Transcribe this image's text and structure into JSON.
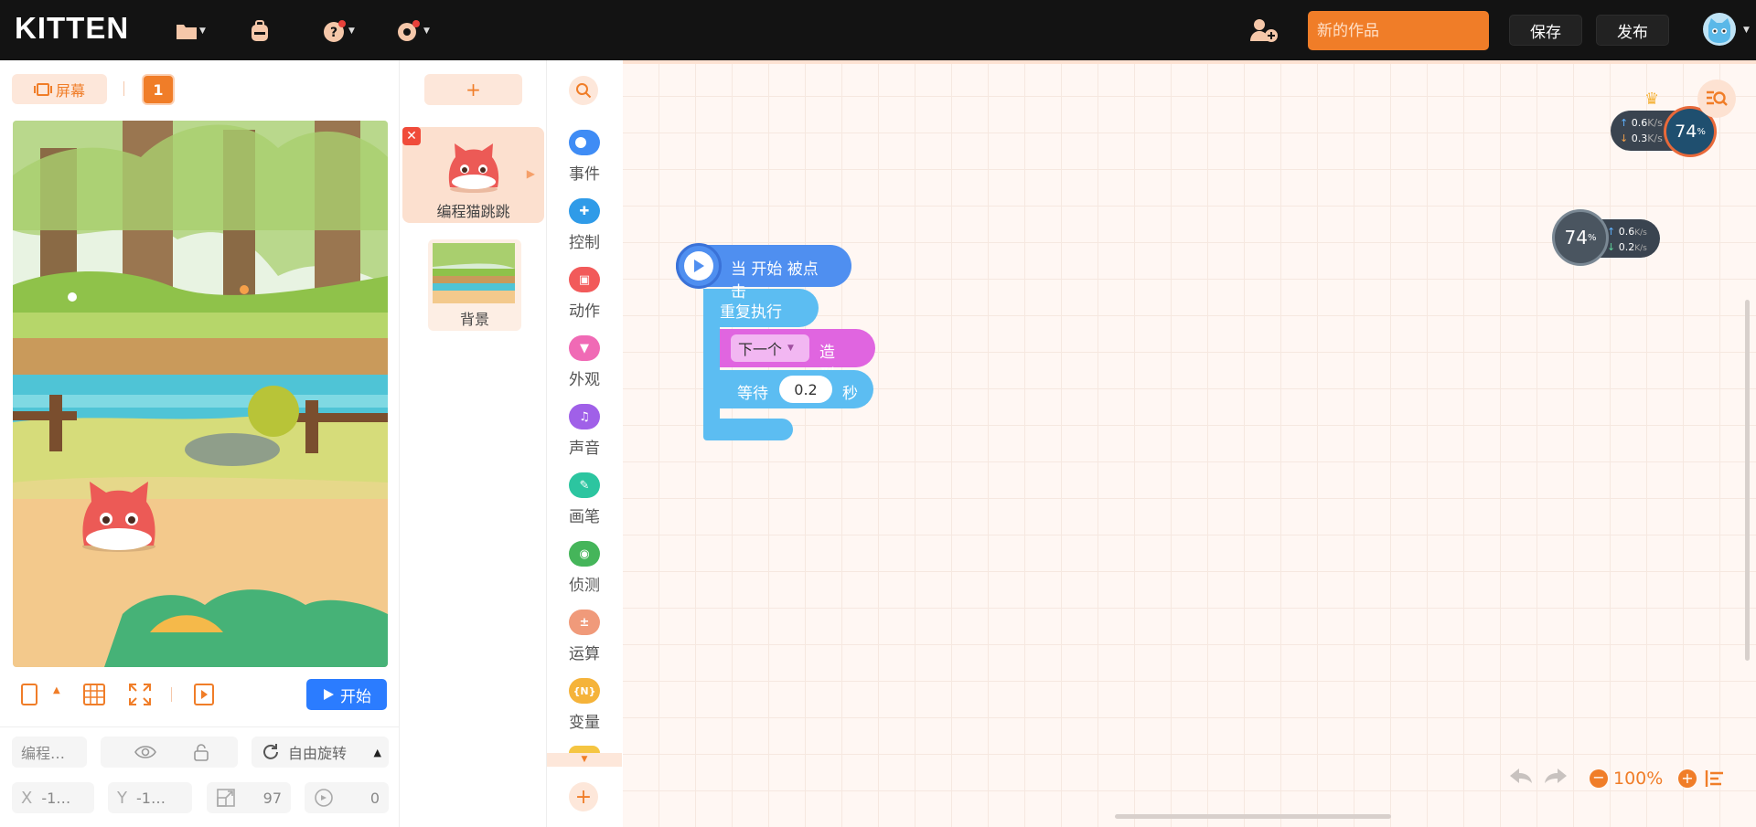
{
  "app": {
    "logo": "KITTEN"
  },
  "topbar": {
    "project_placeholder": "新的作品",
    "save_label": "保存",
    "publish_label": "发布"
  },
  "stage_panel": {
    "screen_label": "屏幕",
    "screen_number": "1",
    "start_label": "开始",
    "sprite_name": "编程…",
    "rotation_label": "自由旋转",
    "x_label": "X",
    "x_value": "-1…",
    "y_label": "Y",
    "y_value": "-1…",
    "size_value": "97",
    "direction_value": "0"
  },
  "sprites": {
    "add_label": "+",
    "items": [
      {
        "name": "编程猫跳跳"
      }
    ],
    "background_label": "背景"
  },
  "categories": [
    {
      "label": "事件",
      "color": "#3f8cf5",
      "icon": "toggle-icon"
    },
    {
      "label": "控制",
      "color": "#2f9be8",
      "icon": "gamepad-icon"
    },
    {
      "label": "动作",
      "color": "#f25a5a",
      "icon": "motion-icon"
    },
    {
      "label": "外观",
      "color": "#f06ab5",
      "icon": "shirt-icon"
    },
    {
      "label": "声音",
      "color": "#a060e8",
      "icon": "music-icon"
    },
    {
      "label": "画笔",
      "color": "#2cc5a0",
      "icon": "pen-icon"
    },
    {
      "label": "侦测",
      "color": "#45b55a",
      "icon": "sensor-icon"
    },
    {
      "label": "运算",
      "color": "#f09a7a",
      "icon": "math-icon"
    },
    {
      "label": "变量",
      "color": "#f5b33a",
      "icon": "variable-icon"
    }
  ],
  "blocks": {
    "hat": "当 开始 被点击",
    "repeat": "重复执行",
    "costume_dropdown": "下一个",
    "costume_label": "造型",
    "wait_label": "等待",
    "wait_value": "0.2",
    "wait_unit": "秒"
  },
  "monitors": {
    "top": {
      "up": "0.6",
      "down": "0.3",
      "unit": "K/s",
      "percent": "74",
      "percent_sign": "%"
    },
    "side": {
      "up": "0.6",
      "down": "0.2",
      "unit": "K/s",
      "percent": "74",
      "percent_sign": "%"
    }
  },
  "workspace": {
    "zoom": "100%"
  },
  "colors": {
    "accent": "#f07d28",
    "topbar": "#131313",
    "start": "#2b7cff",
    "event_block": "#4f8ff0",
    "control_block": "#5cbdf2",
    "look_block": "#e065e0"
  }
}
